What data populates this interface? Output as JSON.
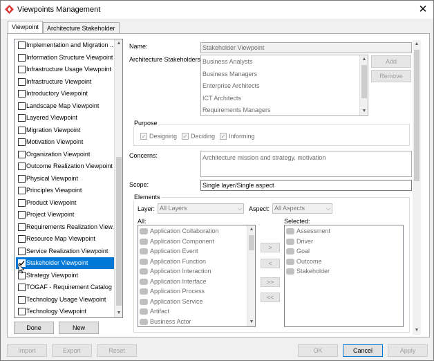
{
  "window": {
    "title": "Viewpoints Management",
    "close_glyph": "✕"
  },
  "tabs": [
    {
      "label": "Viewpoint",
      "active": true
    },
    {
      "label": "Architecture Stakeholder",
      "active": false
    }
  ],
  "viewpoint_list": {
    "items": [
      {
        "label": "Implementation and Migration ...",
        "checked": false,
        "selected": false
      },
      {
        "label": "Information Structure Viewpoint",
        "checked": false,
        "selected": false
      },
      {
        "label": "Infrastructure Usage Viewpoint",
        "checked": false,
        "selected": false
      },
      {
        "label": "Infrastructure Viewpoint",
        "checked": false,
        "selected": false
      },
      {
        "label": "Introductory Viewpoint",
        "checked": false,
        "selected": false
      },
      {
        "label": "Landscape Map Viewpoint",
        "checked": false,
        "selected": false
      },
      {
        "label": "Layered Viewpoint",
        "checked": false,
        "selected": false
      },
      {
        "label": "Migration Viewpoint",
        "checked": false,
        "selected": false
      },
      {
        "label": "Motivation Viewpoint",
        "checked": false,
        "selected": false
      },
      {
        "label": "Organization Viewpoint",
        "checked": false,
        "selected": false
      },
      {
        "label": "Outcome Realization Viewpoint",
        "checked": false,
        "selected": false
      },
      {
        "label": "Physical Viewpoint",
        "checked": false,
        "selected": false
      },
      {
        "label": "Principles Viewpoint",
        "checked": false,
        "selected": false
      },
      {
        "label": "Product Viewpoint",
        "checked": false,
        "selected": false
      },
      {
        "label": "Project Viewpoint",
        "checked": false,
        "selected": false
      },
      {
        "label": "Requirements Realization View...",
        "checked": false,
        "selected": false
      },
      {
        "label": "Resource Map Viewpoint",
        "checked": false,
        "selected": false
      },
      {
        "label": "Service Realization Viewpoint",
        "checked": false,
        "selected": false
      },
      {
        "label": "Stakeholder Viewpoint",
        "checked": true,
        "selected": true
      },
      {
        "label": "Strategy Viewpoint",
        "checked": false,
        "selected": false
      },
      {
        "label": "TOGAF - Requirement Catalog",
        "checked": false,
        "selected": false
      },
      {
        "label": "Technology Usage Viewpoint",
        "checked": false,
        "selected": false
      },
      {
        "label": "Technology Viewpoint",
        "checked": false,
        "selected": false
      }
    ],
    "done_label": "Done",
    "new_label": "New"
  },
  "form": {
    "name_label": "Name:",
    "name_value": "Stakeholder Viewpoint",
    "stakeholders_label": "Architecture Stakeholders:",
    "stakeholders": [
      "Business Analysts",
      "Business Managers",
      "Enterprise Architects",
      "ICT Architects",
      "Requirements Managers"
    ],
    "add_label": "Add",
    "remove_label": "Remove",
    "purpose_label": "Purpose",
    "purpose_options": [
      {
        "label": "Designing",
        "checked": true
      },
      {
        "label": "Deciding",
        "checked": true
      },
      {
        "label": "Informing",
        "checked": true
      }
    ],
    "concerns_label": "Concerns:",
    "concerns_value": "Architecture mission and strategy, motivation",
    "scope_label": "Scope:",
    "scope_value": "Single layer/Single aspect",
    "elements_label": "Elements",
    "layer_label": "Layer:",
    "layer_value": "All Layers",
    "aspect_label": "Aspect:",
    "aspect_value": "All Aspects",
    "all_label": "All:",
    "selected_label": "Selected:",
    "all_elements": [
      {
        "label": "Application Collaboration",
        "icon": "app-collaboration-icon"
      },
      {
        "label": "Application Component",
        "icon": "app-component-icon"
      },
      {
        "label": "Application Event",
        "icon": "app-event-icon"
      },
      {
        "label": "Application Function",
        "icon": "app-function-icon"
      },
      {
        "label": "Application Interaction",
        "icon": "app-interaction-icon"
      },
      {
        "label": "Application Interface",
        "icon": "app-interface-icon"
      },
      {
        "label": "Application Process",
        "icon": "app-process-icon"
      },
      {
        "label": "Application Service",
        "icon": "app-service-icon"
      },
      {
        "label": "Artifact",
        "icon": "artifact-icon"
      },
      {
        "label": "Business Actor",
        "icon": "business-actor-icon"
      }
    ],
    "selected_elements": [
      {
        "label": "Assessment",
        "icon": "assessment-icon"
      },
      {
        "label": "Driver",
        "icon": "driver-icon"
      },
      {
        "label": "Goal",
        "icon": "goal-icon"
      },
      {
        "label": "Outcome",
        "icon": "outcome-icon"
      },
      {
        "label": "Stakeholder",
        "icon": "stakeholder-icon"
      }
    ],
    "move_buttons": {
      "add_one": ">",
      "remove_one": "<",
      "add_all": ">>",
      "remove_all": "<<"
    }
  },
  "footer": {
    "import_label": "Import",
    "export_label": "Export",
    "reset_label": "Reset",
    "ok_label": "OK",
    "cancel_label": "Cancel",
    "apply_label": "Apply"
  },
  "colors": {
    "selection": "#0078d7",
    "window_bg": "#f0f0f0"
  }
}
